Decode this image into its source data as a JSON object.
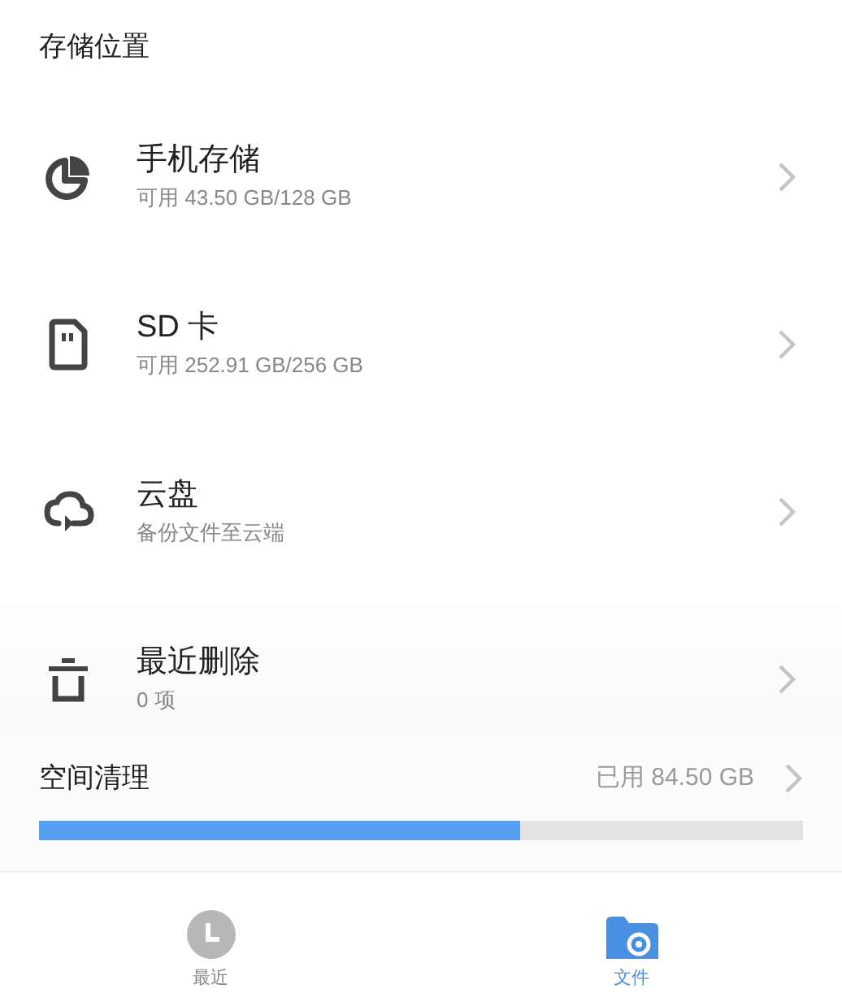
{
  "section_title": "存储位置",
  "locations": [
    {
      "kind": "phone",
      "title": "手机存储",
      "subtitle": "可用 43.50 GB/128 GB"
    },
    {
      "kind": "sd",
      "title": "SD 卡",
      "subtitle": "可用 252.91 GB/256 GB"
    },
    {
      "kind": "cloud",
      "title": "云盘",
      "subtitle": "备份文件至云端"
    },
    {
      "kind": "trash",
      "title": "最近删除",
      "subtitle": "0 项"
    }
  ],
  "cleanup": {
    "title": "空间清理",
    "used": "已用 84.50 GB",
    "level": 0.63
  },
  "tabs": [
    {
      "kind": "recent",
      "label": "最近",
      "selected": false
    },
    {
      "kind": "files",
      "label": "文件",
      "selected": true
    }
  ]
}
